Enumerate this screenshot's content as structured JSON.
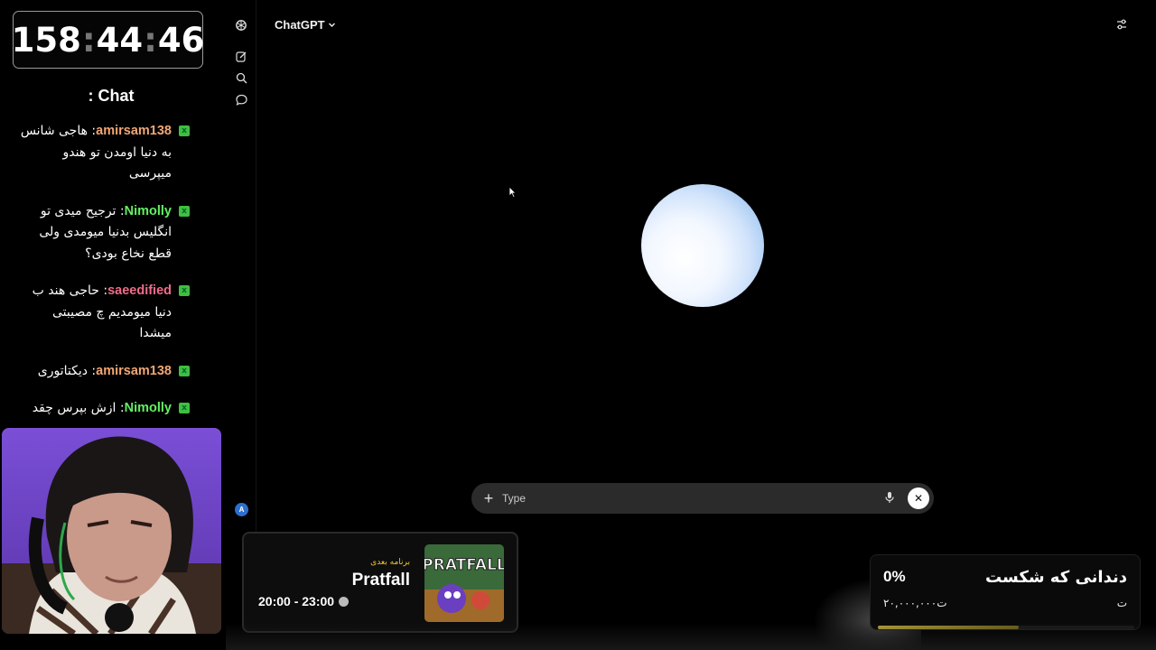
{
  "stream": {
    "timer": {
      "hours": "158",
      "minutes": "44",
      "seconds": "46"
    },
    "chat_title": ": Chat",
    "messages": [
      {
        "user": "amirsam138",
        "user_color": "#f1a774",
        "text": "هاجی شانس به دنیا اومدن تو هندو میپرسی"
      },
      {
        "user": "Nimolly",
        "user_color": "#62f062",
        "text": "ترجیح میدی تو انگلیس بدنیا میومدی ولی قطع نخاع بودی؟"
      },
      {
        "user": "saeedified",
        "user_color": "#f06c8a",
        "text": "حاجی هند ب دنیا میومدیم چ مصیبتی میشدا"
      },
      {
        "user": "amirsam138",
        "user_color": "#f1a774",
        "text": "دیکتاتوری"
      },
      {
        "user": "Nimolly",
        "user_color": "#62f062",
        "text": "ازش بپرس چقد"
      }
    ],
    "badge_icon": "mod-badge-icon"
  },
  "chatgpt": {
    "model_label": "ChatGPT",
    "composer": {
      "placeholder": "Type"
    },
    "avatar_initial": "A",
    "icons": [
      "openai-logo-icon",
      "new-chat-icon",
      "search-icon",
      "chat-bubble-icon",
      "settings-sliders-icon",
      "plus-icon",
      "mic-icon",
      "close-icon"
    ]
  },
  "next_show": {
    "label": "برنامه بعدی",
    "title": "Pratfall",
    "time": "20:00 - 23:00",
    "thumb_text": "PRATFALL"
  },
  "goal": {
    "title": "دندانی که شکست",
    "percent": "0%",
    "progress": 0,
    "amount": "۲۰,۰۰۰,۰۰۰ت",
    "currency": "ت"
  },
  "colors": {
    "accent_yellow": "#f2c531",
    "badge_green": "#3fbf3f",
    "orb_blue": "#9ec4f0"
  }
}
